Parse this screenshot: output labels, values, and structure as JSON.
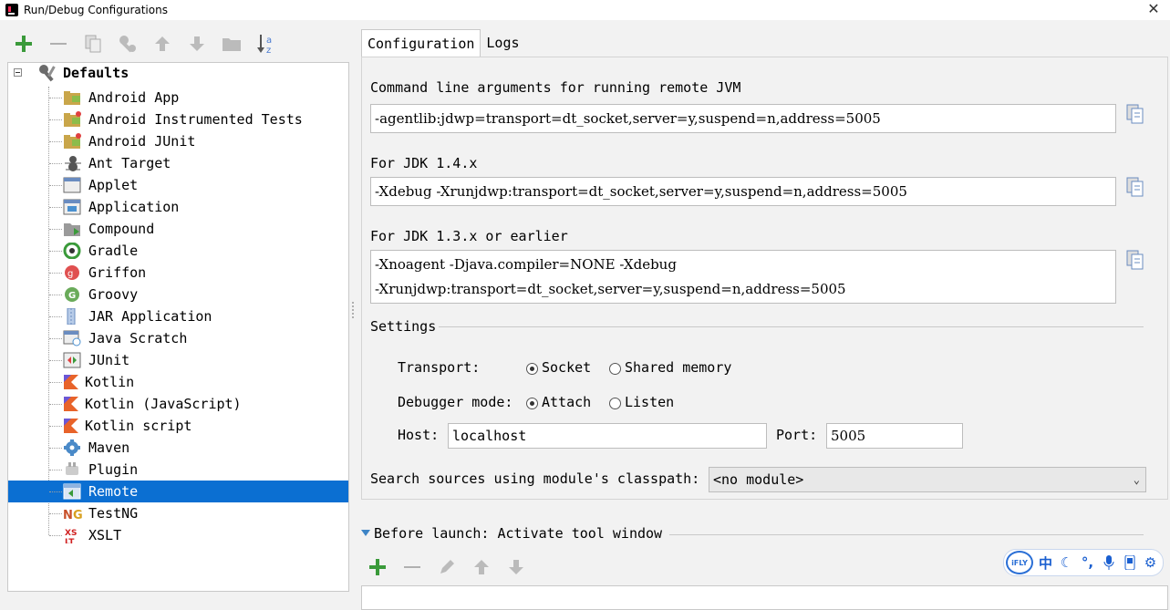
{
  "window": {
    "title": "Run/Debug Configurations"
  },
  "toolbar": {
    "add": "add-icon",
    "remove": "remove-icon",
    "copy": "copy-icon",
    "edit_defaults": "wrench-icon",
    "move_up": "arrow-up-icon",
    "move_down": "arrow-down-icon",
    "folder": "folder-icon",
    "sort": "sort-az-icon"
  },
  "tree": {
    "root_label": "Defaults",
    "items": [
      {
        "label": "Android App",
        "icon": "android-icon"
      },
      {
        "label": "Android Instrumented Tests",
        "icon": "android-test-icon"
      },
      {
        "label": "Android JUnit",
        "icon": "android-junit-icon"
      },
      {
        "label": "Ant Target",
        "icon": "ant-icon"
      },
      {
        "label": "Applet",
        "icon": "applet-icon"
      },
      {
        "label": "Application",
        "icon": "application-icon"
      },
      {
        "label": "Compound",
        "icon": "compound-icon"
      },
      {
        "label": "Gradle",
        "icon": "gradle-icon"
      },
      {
        "label": "Griffon",
        "icon": "griffon-icon"
      },
      {
        "label": "Groovy",
        "icon": "groovy-icon"
      },
      {
        "label": "JAR Application",
        "icon": "jar-icon"
      },
      {
        "label": "Java Scratch",
        "icon": "java-scratch-icon"
      },
      {
        "label": "JUnit",
        "icon": "junit-icon"
      },
      {
        "label": "Kotlin",
        "icon": "kotlin-icon"
      },
      {
        "label": "Kotlin (JavaScript)",
        "icon": "kotlin-js-icon"
      },
      {
        "label": "Kotlin script",
        "icon": "kotlin-script-icon"
      },
      {
        "label": "Maven",
        "icon": "maven-icon"
      },
      {
        "label": "Plugin",
        "icon": "plugin-icon"
      },
      {
        "label": "Remote",
        "icon": "remote-icon"
      },
      {
        "label": "TestNG",
        "icon": "testng-icon"
      },
      {
        "label": "XSLT",
        "icon": "xslt-icon"
      }
    ],
    "selected_label": "Remote"
  },
  "tabs": [
    {
      "label": "Configuration"
    },
    {
      "label": "Logs"
    }
  ],
  "config": {
    "cmd_label": "Command line arguments for running remote JVM",
    "cmd_value": "-agentlib:jdwp=transport=dt_socket,server=y,suspend=n,address=5005",
    "jdk14_label": "For JDK 1.4.x",
    "jdk14_value": "-Xdebug -Xrunjdwp:transport=dt_socket,server=y,suspend=n,address=5005",
    "jdk13_label": "For JDK 1.3.x or earlier",
    "jdk13_line1": "-Xnoagent -Djava.compiler=NONE -Xdebug",
    "jdk13_line2": "-Xrunjdwp:transport=dt_socket,server=y,suspend=n,address=5005",
    "settings_label": "Settings",
    "transport_label": "Transport:",
    "transport_socket": "Socket",
    "transport_shared": "Shared memory",
    "debugger_label": "Debugger mode:",
    "debugger_attach": "Attach",
    "debugger_listen": "Listen",
    "host_label": "Host:",
    "host_value": "localhost",
    "port_label": "Port:",
    "port_value": "5005",
    "classpath_label": "Search sources using module's classpath:",
    "classpath_value": "<no module>"
  },
  "before_launch": {
    "title": "Before launch: Activate tool window"
  },
  "ime": {
    "logo": "iFLY",
    "lang": "中"
  },
  "colors": {
    "selection": "#0b6fd2",
    "add_green": "#3a9a3a",
    "link_blue": "#3d84c6"
  }
}
